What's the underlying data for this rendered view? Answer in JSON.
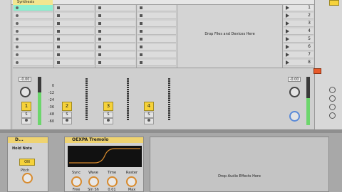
{
  "session": {
    "track_headers": [
      "Synthesis",
      "",
      "",
      ""
    ],
    "drop_files_text": "Drop Files and Devices Here",
    "scene_numbers": [
      "1",
      "2",
      "3",
      "4",
      "5",
      "6",
      "7",
      "8"
    ],
    "track_numbers": [
      "1",
      "2",
      "3",
      "4"
    ],
    "volume_display": "-0.00",
    "master_volume_display": "-0.00",
    "db_scale": [
      "0",
      "-12",
      "-24",
      "-36",
      "-48",
      "-60"
    ],
    "solo_label": "S",
    "monitor_label": "O"
  },
  "devices": {
    "midi_device": {
      "title": "D...",
      "hold_label": "Hold Note",
      "on_label": "ON",
      "pitch_label": "Pitch"
    },
    "tremolo": {
      "title": "OEXPA Tremolo",
      "knobs": [
        {
          "label": "Sync",
          "value": "Free"
        },
        {
          "label": "Wave",
          "value": "Sin Sh"
        },
        {
          "label": "Time",
          "value": "0.01"
        },
        {
          "label": "Raster",
          "value": "Max"
        }
      ]
    },
    "drop_audio_effects_text": "Drop Audio Effects Here"
  },
  "colors": {
    "accent": "#f6d23a",
    "selected_clip": "#8ef0d0",
    "meter": "#6cd66c",
    "knob_ring": "#d88a2c"
  }
}
